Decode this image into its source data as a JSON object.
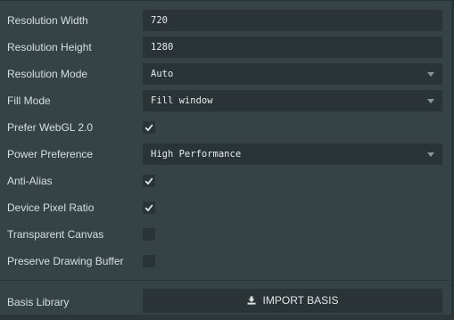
{
  "settings": {
    "resolution_width": {
      "label": "Resolution Width",
      "value": "720"
    },
    "resolution_height": {
      "label": "Resolution Height",
      "value": "1280"
    },
    "resolution_mode": {
      "label": "Resolution Mode",
      "value": "Auto"
    },
    "fill_mode": {
      "label": "Fill Mode",
      "value": "Fill window"
    },
    "prefer_webgl2": {
      "label": "Prefer WebGL 2.0",
      "checked": true
    },
    "power_preference": {
      "label": "Power Preference",
      "value": "High Performance"
    },
    "anti_alias": {
      "label": "Anti-Alias",
      "checked": true
    },
    "device_pixel_ratio": {
      "label": "Device Pixel Ratio",
      "checked": true
    },
    "transparent_canvas": {
      "label": "Transparent Canvas",
      "checked": false
    },
    "preserve_drawing_buffer": {
      "label": "Preserve Drawing Buffer",
      "checked": false
    },
    "basis_library": {
      "label": "Basis Library",
      "button_label": "IMPORT BASIS",
      "button_icon": "download-icon"
    }
  },
  "colors": {
    "panel_background": "#364346",
    "field_background": "#2a3437",
    "text": "#d7dedf"
  }
}
